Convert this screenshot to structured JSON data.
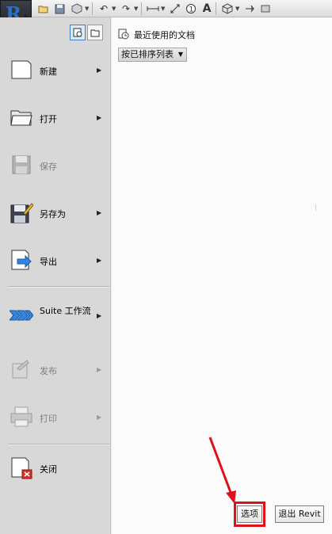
{
  "qat": {
    "icons": [
      "open-folder-icon",
      "save-icon",
      "sync-icon",
      "undo-icon",
      "redo-icon",
      "measure-icon",
      "dimension-icon",
      "tag-icon",
      "text-icon",
      "3d-view-icon",
      "section-icon",
      "more-icon"
    ]
  },
  "app_menu": {
    "view_buttons": [
      "recent-documents-icon",
      "open-documents-icon"
    ],
    "items": [
      {
        "label": "新建",
        "enabled": true
      },
      {
        "label": "打开",
        "enabled": true
      },
      {
        "label": "保存",
        "enabled": false
      },
      {
        "label": "另存为",
        "enabled": true
      },
      {
        "label": "导出",
        "enabled": true
      },
      {
        "label": "Suite 工作流",
        "enabled": true
      },
      {
        "label": "发布",
        "enabled": false
      },
      {
        "label": "打印",
        "enabled": false
      },
      {
        "label": "关闭",
        "enabled": true
      }
    ]
  },
  "recent": {
    "title": "最近使用的文档",
    "sort_label": "按已排序列表"
  },
  "footer": {
    "options_label": "选项",
    "exit_label": "退出 Revit"
  },
  "colors": {
    "highlight": "#e0101a",
    "accent": "#2e6dbf"
  }
}
